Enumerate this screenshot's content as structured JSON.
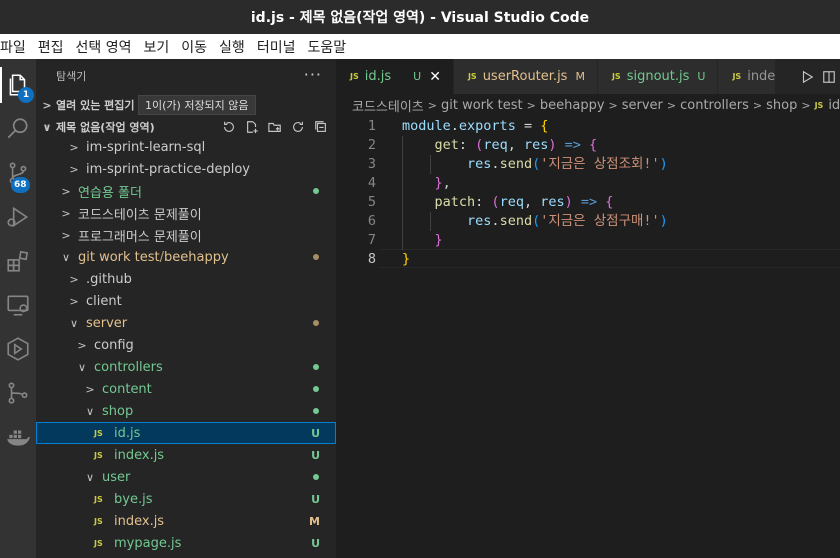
{
  "window": {
    "title": "id.js - 제목 없음(작업 영역) - Visual Studio Code"
  },
  "menu": [
    "파일",
    "편집",
    "선택 영역",
    "보기",
    "이동",
    "실행",
    "터미널",
    "도움말"
  ],
  "activity": {
    "explorer_badge": "1",
    "scm_badge": "68"
  },
  "sidebar": {
    "title": "탐색기",
    "more": "···",
    "open_editors": "열려 있는 편집기",
    "tooltip": "1이(가) 저장되지 않음",
    "workspace": "제목 없음(작업 영역)",
    "tree": [
      {
        "label": "im-sprint-learn-sql",
        "kind": "folder",
        "open": false,
        "depth": 2
      },
      {
        "label": "im-sprint-practice-deploy",
        "kind": "folder",
        "open": false,
        "depth": 2
      },
      {
        "label": "연습용 폴더",
        "kind": "folder",
        "open": false,
        "depth": 1,
        "color": "git",
        "dot": "#73c991"
      },
      {
        "label": "코드스테이츠 문제풀이",
        "kind": "folder",
        "open": false,
        "depth": 1
      },
      {
        "label": "프로그래머스 문제풀이",
        "kind": "folder",
        "open": false,
        "depth": 1
      },
      {
        "label": "git work test",
        "label2": "beehappy",
        "kind": "folder",
        "open": true,
        "depth": 1,
        "color": "mod",
        "dot": "#a58e63"
      },
      {
        "label": ".github",
        "kind": "folder",
        "open": false,
        "depth": 2
      },
      {
        "label": "client",
        "kind": "folder",
        "open": false,
        "depth": 2
      },
      {
        "label": "server",
        "kind": "folder",
        "open": true,
        "depth": 2,
        "color": "mod",
        "dot": "#a58e63"
      },
      {
        "label": "config",
        "kind": "folder",
        "open": false,
        "depth": 3
      },
      {
        "label": "controllers",
        "kind": "folder",
        "open": true,
        "depth": 3,
        "color": "git",
        "dot": "#73c991"
      },
      {
        "label": "content",
        "kind": "folder",
        "open": false,
        "depth": 4,
        "color": "git",
        "dot": "#73c991"
      },
      {
        "label": "shop",
        "kind": "folder",
        "open": true,
        "depth": 4,
        "color": "git",
        "dot": "#73c991"
      },
      {
        "label": "id.js",
        "kind": "file",
        "depth": 5,
        "color": "git",
        "status": "U",
        "status_color": "#73c991",
        "selected": true
      },
      {
        "label": "index.js",
        "kind": "file",
        "depth": 5,
        "color": "git",
        "status": "U",
        "status_color": "#73c991"
      },
      {
        "label": "user",
        "kind": "folder",
        "open": true,
        "depth": 4,
        "color": "git",
        "dot": "#73c991"
      },
      {
        "label": "bye.js",
        "kind": "file",
        "depth": 5,
        "color": "git",
        "status": "U",
        "status_color": "#73c991"
      },
      {
        "label": "index.js",
        "kind": "file",
        "depth": 5,
        "color": "mod",
        "status": "M",
        "status_color": "#e2c08d"
      },
      {
        "label": "mypage.js",
        "kind": "file",
        "depth": 5,
        "color": "git",
        "status": "U",
        "status_color": "#73c991"
      }
    ]
  },
  "tabs": [
    {
      "label": "id.js",
      "status": "U",
      "active": true,
      "close": "✕"
    },
    {
      "label": "userRouter.js",
      "status": "M",
      "active": false
    },
    {
      "label": "signout.js",
      "status": "U",
      "active": false
    },
    {
      "label": "inde",
      "status": "",
      "active": false
    }
  ],
  "file_icon": "JS",
  "breadcrumb": [
    "코드스테이츠",
    "git work test",
    "beehappy",
    "server",
    "controllers",
    "shop",
    "id.js"
  ],
  "code": {
    "line_numbers": [
      "1",
      "2",
      "3",
      "4",
      "5",
      "6",
      "7",
      "8"
    ],
    "current_line": 8,
    "lines": [
      [
        [
          "k-var",
          "module"
        ],
        [
          "k-plain",
          "."
        ],
        [
          "k-var",
          "exports"
        ],
        [
          "k-plain",
          " = "
        ],
        [
          "b1",
          "{"
        ]
      ],
      [
        [
          "k-plain",
          "    "
        ],
        [
          "k-fn",
          "get"
        ],
        [
          "k-plain",
          ": "
        ],
        [
          "b2",
          "("
        ],
        [
          "k-var",
          "req"
        ],
        [
          "k-plain",
          ", "
        ],
        [
          "k-var",
          "res"
        ],
        [
          "b2",
          ")"
        ],
        [
          "k-plain",
          " "
        ],
        [
          "k-arrow",
          "=>"
        ],
        [
          "k-plain",
          " "
        ],
        [
          "b2",
          "{"
        ]
      ],
      [
        [
          "k-plain",
          "        "
        ],
        [
          "k-var",
          "res"
        ],
        [
          "k-plain",
          "."
        ],
        [
          "k-fn",
          "send"
        ],
        [
          "b3",
          "("
        ],
        [
          "k-str",
          "'지금은 상점조회!'"
        ],
        [
          "b3",
          ")"
        ]
      ],
      [
        [
          "k-plain",
          "    "
        ],
        [
          "b2",
          "}"
        ],
        [
          "k-plain",
          ","
        ]
      ],
      [
        [
          "k-plain",
          "    "
        ],
        [
          "k-fn",
          "patch"
        ],
        [
          "k-plain",
          ": "
        ],
        [
          "b2",
          "("
        ],
        [
          "k-var",
          "req"
        ],
        [
          "k-plain",
          ", "
        ],
        [
          "k-var",
          "res"
        ],
        [
          "b2",
          ")"
        ],
        [
          "k-plain",
          " "
        ],
        [
          "k-arrow",
          "=>"
        ],
        [
          "k-plain",
          " "
        ],
        [
          "b2",
          "{"
        ]
      ],
      [
        [
          "k-plain",
          "        "
        ],
        [
          "k-var",
          "res"
        ],
        [
          "k-plain",
          "."
        ],
        [
          "k-fn",
          "send"
        ],
        [
          "b3",
          "("
        ],
        [
          "k-str",
          "'지금은 상점구매!'"
        ],
        [
          "b3",
          ")"
        ]
      ],
      [
        [
          "k-plain",
          "    "
        ],
        [
          "b2",
          "}"
        ]
      ],
      [
        [
          "b1",
          "}"
        ]
      ]
    ]
  },
  "colors": {
    "accent": "#0e70c0",
    "untracked": "#73c991",
    "modified": "#e2c08d",
    "selection": "#04395e"
  }
}
